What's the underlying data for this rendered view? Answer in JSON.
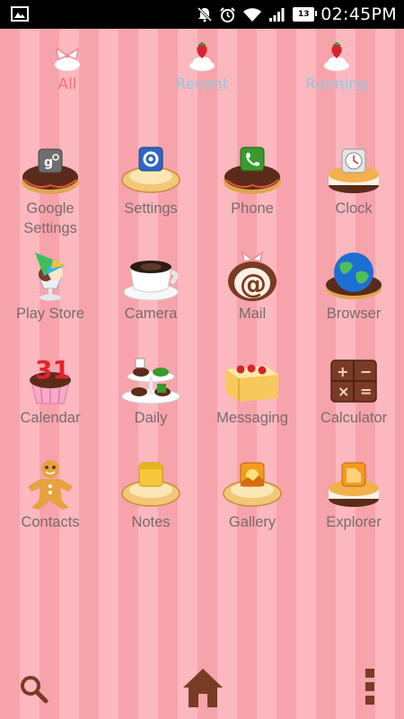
{
  "status_bar": {
    "time": "02:45PM",
    "battery_level": "13",
    "icons": [
      "image-notification-icon",
      "mute-icon",
      "alarm-icon",
      "wifi-icon",
      "signal-icon",
      "battery-icon"
    ]
  },
  "tabs": [
    {
      "label": "All",
      "active": true
    },
    {
      "label": "Recent",
      "active": false
    },
    {
      "label": "Running",
      "active": false
    }
  ],
  "apps": [
    {
      "label_line1": "Google",
      "label_line2": "Settings",
      "icon": "google-settings-donut-icon"
    },
    {
      "label_line1": "Settings",
      "label_line2": "",
      "icon": "settings-tart-icon"
    },
    {
      "label_line1": "Phone",
      "label_line2": "",
      "icon": "phone-donut-icon"
    },
    {
      "label_line1": "Clock",
      "label_line2": "",
      "icon": "clock-cake-icon"
    },
    {
      "label_line1": "Play Store",
      "label_line2": "",
      "icon": "play-store-sundae-icon"
    },
    {
      "label_line1": "Camera",
      "label_line2": "",
      "icon": "coffee-cup-icon"
    },
    {
      "label_line1": "Mail",
      "label_line2": "",
      "icon": "mail-roll-cake-icon"
    },
    {
      "label_line1": "Browser",
      "label_line2": "",
      "icon": "globe-donut-icon"
    },
    {
      "label_line1": "Calendar",
      "label_line2": "",
      "icon": "calendar-cupcake-icon"
    },
    {
      "label_line1": "Daily",
      "label_line2": "",
      "icon": "daily-tiered-stand-icon"
    },
    {
      "label_line1": "Messaging",
      "label_line2": "",
      "icon": "messaging-cake-icon"
    },
    {
      "label_line1": "Calculator",
      "label_line2": "",
      "icon": "calculator-chocolate-icon"
    },
    {
      "label_line1": "Contacts",
      "label_line2": "",
      "icon": "gingerbread-man-icon"
    },
    {
      "label_line1": "Notes",
      "label_line2": "",
      "icon": "notes-tart-icon"
    },
    {
      "label_line1": "Gallery",
      "label_line2": "",
      "icon": "gallery-tart-icon"
    },
    {
      "label_line1": "Explorer",
      "label_line2": "",
      "icon": "explorer-cake-icon"
    }
  ],
  "bottom_bar": {
    "icons": [
      "search-icon",
      "home-icon",
      "menu-dots-icon"
    ]
  },
  "colors": {
    "stripe_dark": "#f7a3ab",
    "stripe_light": "#fbb8bf",
    "tab_active": "#f36f7c",
    "tab_inactive": "#93c9df",
    "label": "#7a6b6d",
    "chocolate": "#7a3b24"
  }
}
